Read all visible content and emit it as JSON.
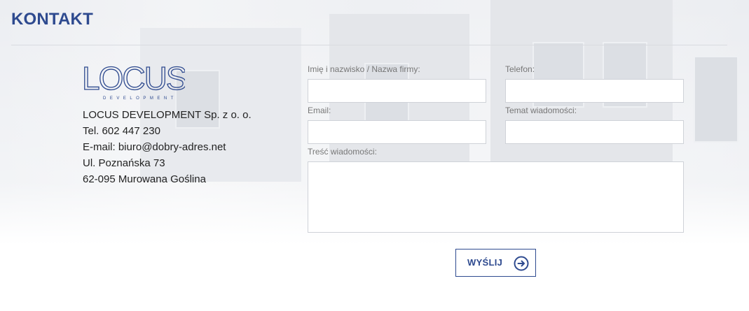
{
  "page": {
    "title": "KONTAKT"
  },
  "logo": {
    "text": "LOCUS",
    "subtext": "DEVELOPMENT"
  },
  "company": {
    "name": "LOCUS DEVELOPMENT Sp. z o. o.",
    "phone": "Tel. 602 447 230",
    "email": "E-mail: biuro@dobry-adres.net",
    "street": "Ul. Poznańska 73",
    "city": "62-095 Murowana Goślina"
  },
  "form": {
    "name_label": "Imię i nazwisko / Nazwa firmy:",
    "phone_label": "Telefon:",
    "email_label": "Email:",
    "subject_label": "Temat wiadomości:",
    "message_label": "Treść wiadomości:",
    "name_value": "",
    "phone_value": "",
    "email_value": "",
    "subject_value": "",
    "message_value": "",
    "submit_label": "WYŚLIJ"
  },
  "colors": {
    "accent": "#2e4a8f",
    "text": "#222222",
    "label": "#777777",
    "border": "#cfd2d8"
  },
  "icons": {
    "submit": "arrow-right-circle-icon"
  }
}
